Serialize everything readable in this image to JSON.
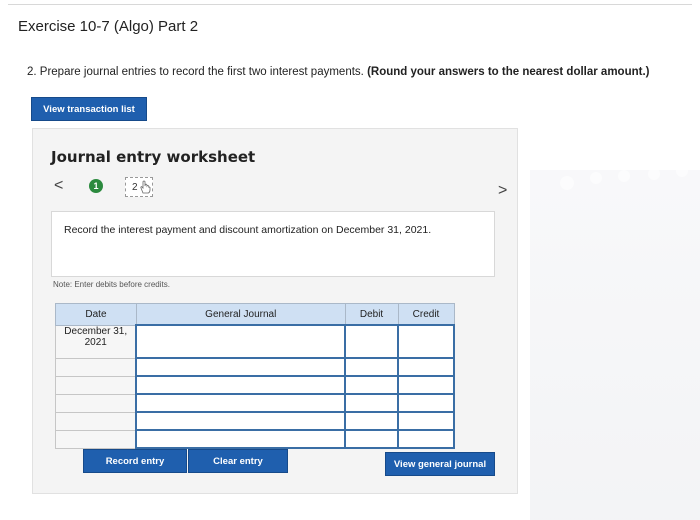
{
  "header": {
    "title": "Exercise 10-7 (Algo) Part 2"
  },
  "question": {
    "text": "2. Prepare journal entries to record the first two interest payments.",
    "emphasis": "(Round your answers to the nearest dollar amount.)"
  },
  "buttons": {
    "view_transaction_list": "View transaction list",
    "record_entry": "Record entry",
    "clear_entry": "Clear entry",
    "view_general_journal": "View general journal"
  },
  "worksheet": {
    "title": "Journal entry worksheet",
    "prev": "<",
    "next": ">",
    "steps": [
      "1",
      "2"
    ],
    "instruction": "Record the interest payment and discount amortization on December 31, 2021.",
    "note": "Note: Enter debits before credits."
  },
  "table": {
    "headers": [
      "Date",
      "General Journal",
      "Debit",
      "Credit"
    ],
    "rows": [
      {
        "date": "December 31, 2021",
        "account": "",
        "debit": "",
        "credit": ""
      },
      {
        "date": "",
        "account": "",
        "debit": "",
        "credit": ""
      },
      {
        "date": "",
        "account": "",
        "debit": "",
        "credit": ""
      },
      {
        "date": "",
        "account": "",
        "debit": "",
        "credit": ""
      },
      {
        "date": "",
        "account": "",
        "debit": "",
        "credit": ""
      },
      {
        "date": "",
        "account": "",
        "debit": "",
        "credit": ""
      }
    ]
  },
  "colors": {
    "button_blue": "#1f5fae",
    "header_blue": "#cfe0f3",
    "step_green": "#2b8a3e"
  }
}
